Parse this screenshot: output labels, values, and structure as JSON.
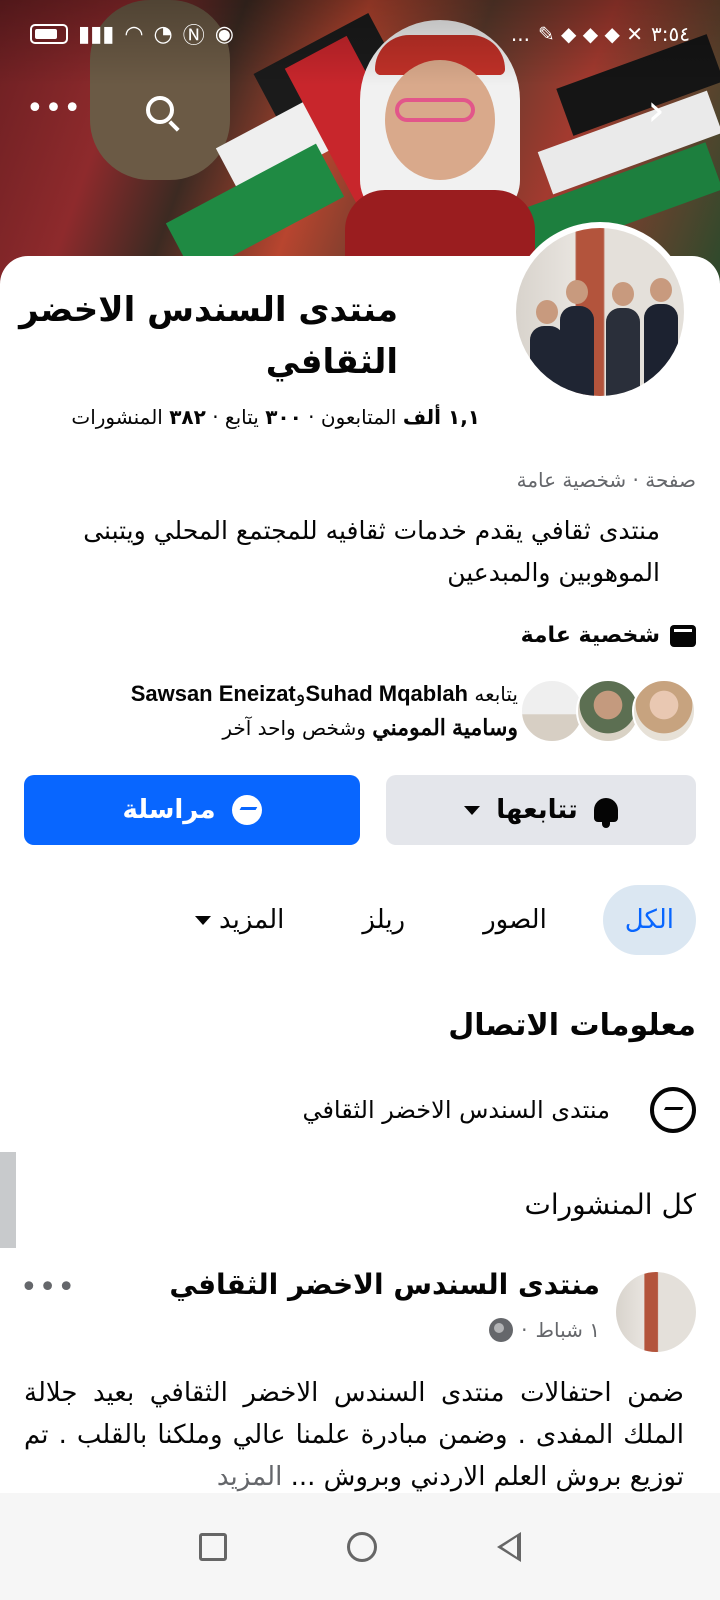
{
  "status_bar": {
    "time": "٣:٥٤",
    "dots": "..."
  },
  "top_actions": {
    "more": "•••",
    "back": "›"
  },
  "page": {
    "title": "منتدى السندس الاخضر الثقافي",
    "followers_count": "١,١ ألف",
    "followers_label": "المتابعون",
    "following_count": "٣٠٠",
    "following_label": "يتابع",
    "posts_count": "٣٨٢",
    "posts_label": "المنشورات",
    "separator": "·",
    "category": "صفحة · شخصية عامة",
    "bio": "منتدى ثقافي يقدم خدمات ثقافيه للمجتمع المحلي ويتبنى الموهوبين والمبدعين",
    "public_figure": "شخصية عامة"
  },
  "followed_by": {
    "prefix": "يتابعه",
    "name1": "Suhad Mqablah",
    "and": "و",
    "name2": "Sawsan Eneizat",
    "name3": "وسامية المومني",
    "suffix": "وشخص واحد آخر"
  },
  "actions": {
    "follow_label": "تتابعها",
    "message_label": "مراسلة"
  },
  "tabs": [
    {
      "label": "الكل"
    },
    {
      "label": "الصور"
    },
    {
      "label": "ريلز"
    },
    {
      "label": "المزيد"
    }
  ],
  "contact": {
    "title": "معلومات الاتصال",
    "messenger_name": "منتدى السندس الاخضر الثقافي"
  },
  "posts_section": {
    "title": "كل المنشورات"
  },
  "post": {
    "author": "منتدى السندس الاخضر الثقافي",
    "date": "١ شباط",
    "dot": "·",
    "more": "•••",
    "text": "ضمن احتفالات منتدى السندس الاخضر الثقافي بعيد جلالة الملك المفدى . وضمن مبادرة علمنا عالي وملكنا بالقلب . تم توزيع بروش العلم الاردني وبروش ...",
    "see_more": "المزيد"
  },
  "colors": {
    "primary_blue": "#0866ff",
    "secondary_gray": "#e4e6eb",
    "text_secondary": "#65676b",
    "active_tab_bg": "#dbe7f2"
  }
}
